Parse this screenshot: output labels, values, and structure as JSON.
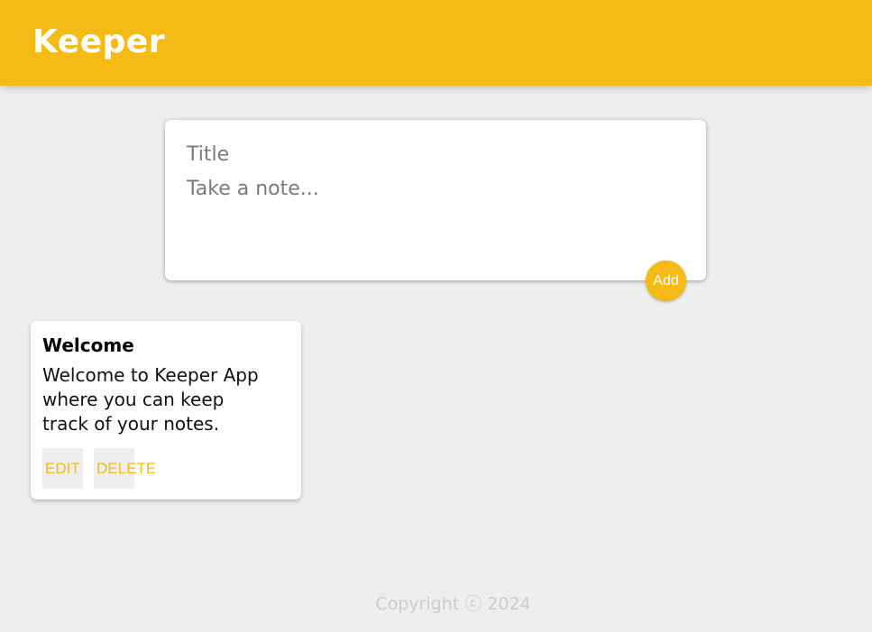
{
  "header": {
    "title": "Keeper"
  },
  "create_form": {
    "title_placeholder": "Title",
    "content_placeholder": "Take a note...",
    "add_label": "Add"
  },
  "notes": [
    {
      "title": "Welcome",
      "content": "Welcome to Keeper App\nwhere you can keep\ntrack of your notes.",
      "edit_label": "EDIT",
      "delete_label": "DELETE"
    }
  ],
  "footer": {
    "text": "Copyright ⓒ 2024"
  },
  "colors": {
    "accent": "#f5ba13",
    "background": "#eeeeee",
    "card": "#ffffff"
  }
}
